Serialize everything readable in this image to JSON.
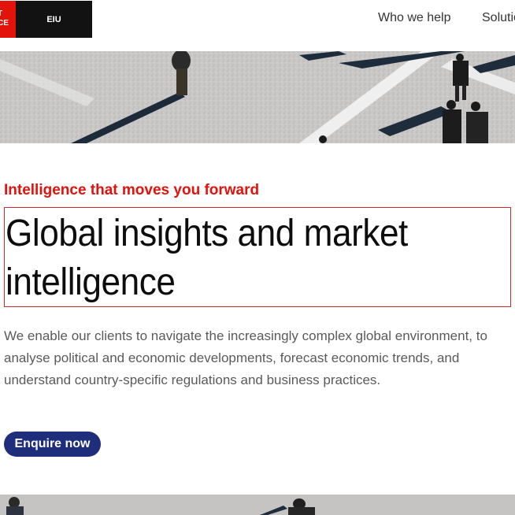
{
  "header": {
    "logo_primary_text": "T\nCE",
    "logo_secondary_text": "EIU",
    "nav_items": [
      "Who we help",
      "Solutio"
    ]
  },
  "hero": {
    "eyebrow": "Intelligence that moves you forward",
    "headline": "Global insights and market intelligence",
    "description": "We enable our clients to navigate the increasingly complex global environment, to analyse political and economic developments, forecast economic trends, and understand country-specific regulations and business practices.",
    "cta_label": "Enquire now"
  },
  "colors": {
    "brand_red": "#e3120b",
    "cta_blue": "#1f2e7a",
    "logo_black": "#121212"
  }
}
